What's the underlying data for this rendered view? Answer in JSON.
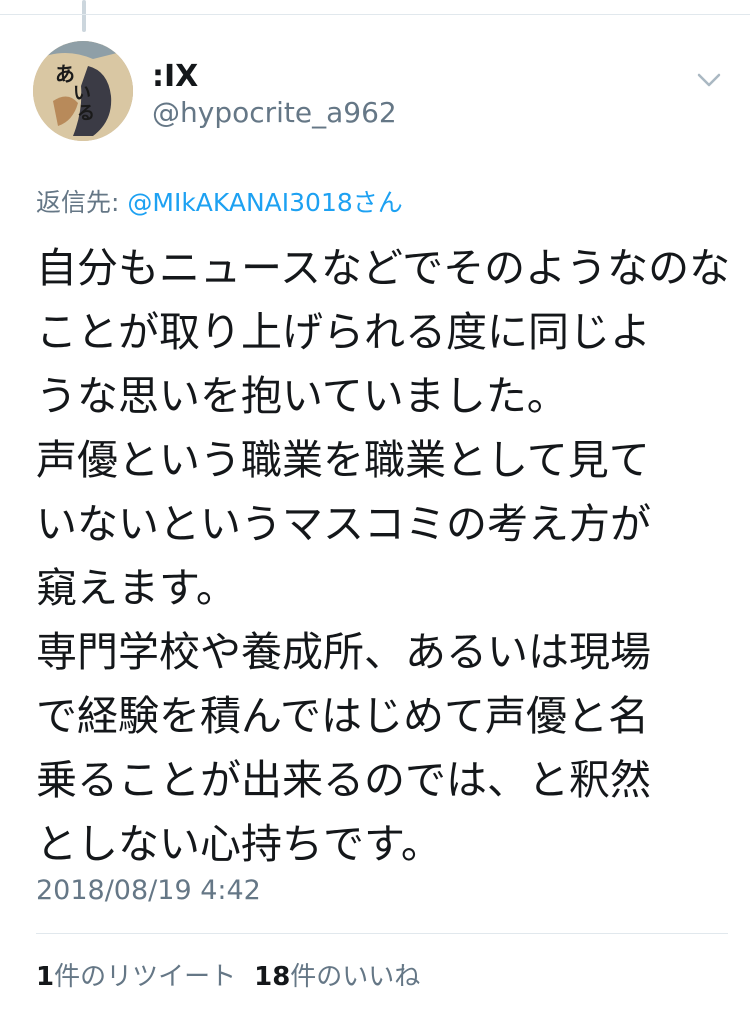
{
  "tweet": {
    "display_name": ":IX",
    "handle": "@hypocrite_a962",
    "reply_prefix": "返信先: ",
    "reply_mention": "@MIkAKANAI3018さん",
    "text_lines": [
      "自分もニュースなどでそのようなのな",
      "ことが取り上げられる度に同じよ",
      "うな思いを抱いていました。",
      "声優という職業を職業として見て",
      "いないというマスコミの考え方が",
      "窺えます。",
      "専門学校や養成所、あるいは現場",
      "で経験を積んではじめて声優と名",
      "乗ることが出来るのでは、と釈然",
      "としない心持ちです。"
    ],
    "timestamp": "2018/08/19 4:42",
    "retweet_count": "1",
    "retweet_label": "件のリツイート",
    "like_count": "18",
    "like_label": "件のいいね"
  },
  "icons": {
    "menu": "chevron-down-icon",
    "avatar": "avatar-image"
  },
  "colors": {
    "text": "#14171a",
    "secondary": "#657786",
    "link": "#1da1f2",
    "divider": "#e1e8ed"
  }
}
